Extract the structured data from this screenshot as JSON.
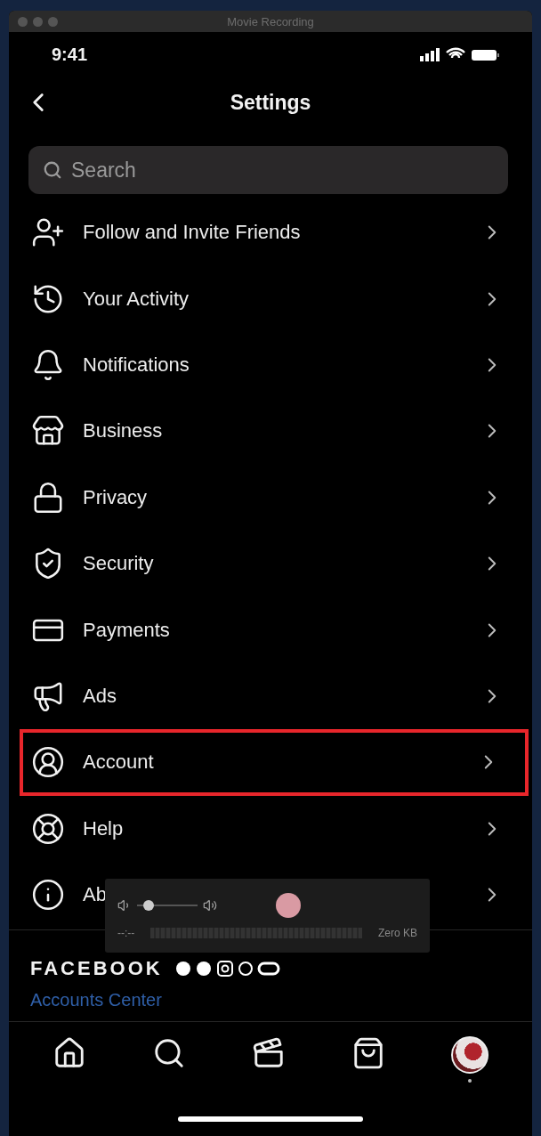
{
  "window": {
    "title": "Movie Recording"
  },
  "status_bar": {
    "time": "9:41"
  },
  "header": {
    "title": "Settings"
  },
  "search": {
    "placeholder": "Search"
  },
  "items": [
    {
      "label": "Follow and Invite Friends",
      "highlighted": false
    },
    {
      "label": "Your Activity",
      "highlighted": false
    },
    {
      "label": "Notifications",
      "highlighted": false
    },
    {
      "label": "Business",
      "highlighted": false
    },
    {
      "label": "Privacy",
      "highlighted": false
    },
    {
      "label": "Security",
      "highlighted": false
    },
    {
      "label": "Payments",
      "highlighted": false
    },
    {
      "label": "Ads",
      "highlighted": false
    },
    {
      "label": "Account",
      "highlighted": true
    },
    {
      "label": "Help",
      "highlighted": false
    },
    {
      "label": "Ab",
      "highlighted": false
    }
  ],
  "recording_overlay": {
    "volume": {
      "level": 0.12
    },
    "elapsed": "--:--",
    "size": "Zero KB"
  },
  "facebook_section": {
    "title": "FACEBOOK",
    "link": "Accounts Center"
  },
  "bottom_nav": [
    {
      "kind": "home"
    },
    {
      "kind": "search"
    },
    {
      "kind": "reels"
    },
    {
      "kind": "shop"
    },
    {
      "kind": "profile",
      "dot": true
    }
  ]
}
